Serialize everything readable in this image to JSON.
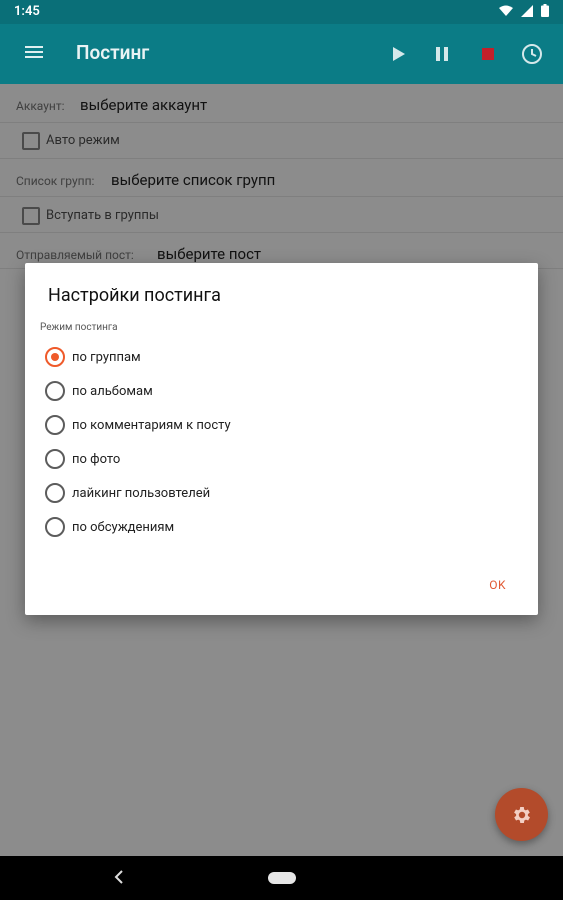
{
  "status": {
    "time": "1:45"
  },
  "appbar": {
    "title": "Постинг"
  },
  "form": {
    "account_label": "Аккаунт:",
    "account_value": "выберите аккаунт",
    "auto_mode": "Авто режим",
    "groups_label": "Список групп:",
    "groups_value": "выберите список групп",
    "join_groups": "Вступать в группы",
    "post_label": "Отправляемый пост:",
    "post_value": "выберите пост"
  },
  "dialog": {
    "title": "Настройки постинга",
    "section": "Режим постинга",
    "options": [
      {
        "label": "по группам",
        "selected": true
      },
      {
        "label": "по альбомам",
        "selected": false
      },
      {
        "label": "по комментариям к посту",
        "selected": false
      },
      {
        "label": "по фото",
        "selected": false
      },
      {
        "label": "лайкинг пользовтелей",
        "selected": false
      },
      {
        "label": "по обсуждениям",
        "selected": false
      }
    ],
    "ok": "OK"
  },
  "colors": {
    "appbar": "#0b7c86",
    "accent": "#ef5a2a",
    "fab": "#b34b2b"
  },
  "icons": [
    "menu-icon",
    "play-icon",
    "pause-icon",
    "stop-icon",
    "clock-icon",
    "gear-icon",
    "wifi-icon",
    "signal-icon",
    "battery-icon",
    "back-icon",
    "home-pill"
  ]
}
